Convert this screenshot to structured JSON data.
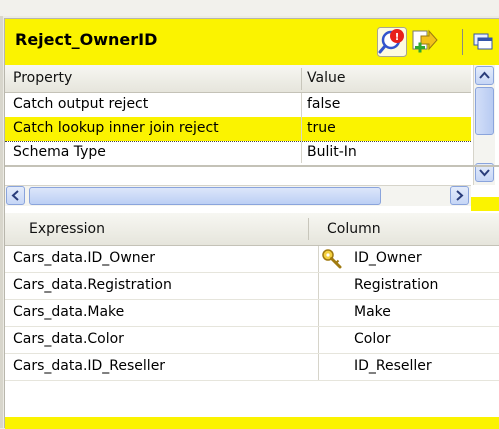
{
  "header": {
    "title": "Reject_OwnerID",
    "icons": [
      "search-alert-icon",
      "add-output-icon",
      "window-icon"
    ],
    "alert_badge": "!"
  },
  "properties": {
    "columns": [
      "Property",
      "Value"
    ],
    "rows": [
      {
        "property": "Catch output reject",
        "value": "false",
        "selected": false
      },
      {
        "property": "Catch lookup inner join reject",
        "value": "true",
        "selected": true
      },
      {
        "property": "Schema Type",
        "value": "Bulit-In",
        "selected": false
      }
    ]
  },
  "expressions": {
    "columns": [
      "Expression",
      "Column"
    ],
    "rows": [
      {
        "expression": "Cars_data.ID_Owner",
        "column": "ID_Owner",
        "key": true
      },
      {
        "expression": "Cars_data.Registration",
        "column": "Registration",
        "key": false
      },
      {
        "expression": "Cars_data.Make",
        "column": "Make",
        "key": false
      },
      {
        "expression": "Cars_data.Color",
        "column": "Color",
        "key": false
      },
      {
        "expression": "Cars_data.ID_Reseller",
        "column": "ID_Reseller",
        "key": false
      }
    ]
  },
  "colors": {
    "highlight": "#fbf300",
    "scrollbar": "#bccff4",
    "alert": "#e8201a"
  }
}
